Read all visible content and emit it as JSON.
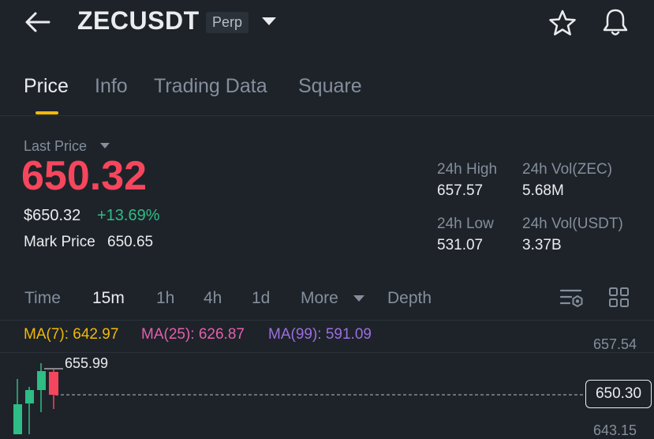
{
  "header": {
    "symbol": "ZECUSDT",
    "contract_type": "Perp"
  },
  "tabs": [
    {
      "label": "Price",
      "active": true
    },
    {
      "label": "Info",
      "active": false
    },
    {
      "label": "Trading Data",
      "active": false
    },
    {
      "label": "Square",
      "active": false
    }
  ],
  "price": {
    "last_price_label": "Last Price",
    "last_price": "650.32",
    "usd_price": "$650.32",
    "change_pct": "+13.69%",
    "mark_price_label": "Mark Price",
    "mark_price": "650.65"
  },
  "stats": {
    "high_label": "24h High",
    "high": "657.57",
    "low_label": "24h Low",
    "low": "531.07",
    "vol_base_label": "24h Vol(ZEC)",
    "vol_base": "5.68M",
    "vol_quote_label": "24h Vol(USDT)",
    "vol_quote": "3.37B"
  },
  "intervals": [
    {
      "label": "Time",
      "active": false
    },
    {
      "label": "15m",
      "active": true
    },
    {
      "label": "1h",
      "active": false
    },
    {
      "label": "4h",
      "active": false
    },
    {
      "label": "1d",
      "active": false
    },
    {
      "label": "More",
      "active": false
    },
    {
      "label": "Depth",
      "active": false
    }
  ],
  "indicators": {
    "ma7": "MA(7): 642.97",
    "ma25": "MA(25): 626.87",
    "ma99": "MA(99): 591.09"
  },
  "chart": {
    "axis_top": "657.54",
    "axis_bottom": "643.15",
    "current_price": "650.30",
    "high_marker": "655.99"
  },
  "colors": {
    "background": "#1e2329",
    "up": "#2ebd85",
    "down": "#f6465d",
    "accent": "#f0b90b",
    "ma7": "#f0b90b",
    "ma25": "#e45fae",
    "ma99": "#9b6fe0"
  },
  "icons": {
    "back": "back-arrow-icon",
    "dropdown": "chevron-down-icon",
    "favorite": "star-icon",
    "alerts": "bell-icon",
    "chart_settings": "chart-settings-icon",
    "layout": "grid-icon"
  }
}
